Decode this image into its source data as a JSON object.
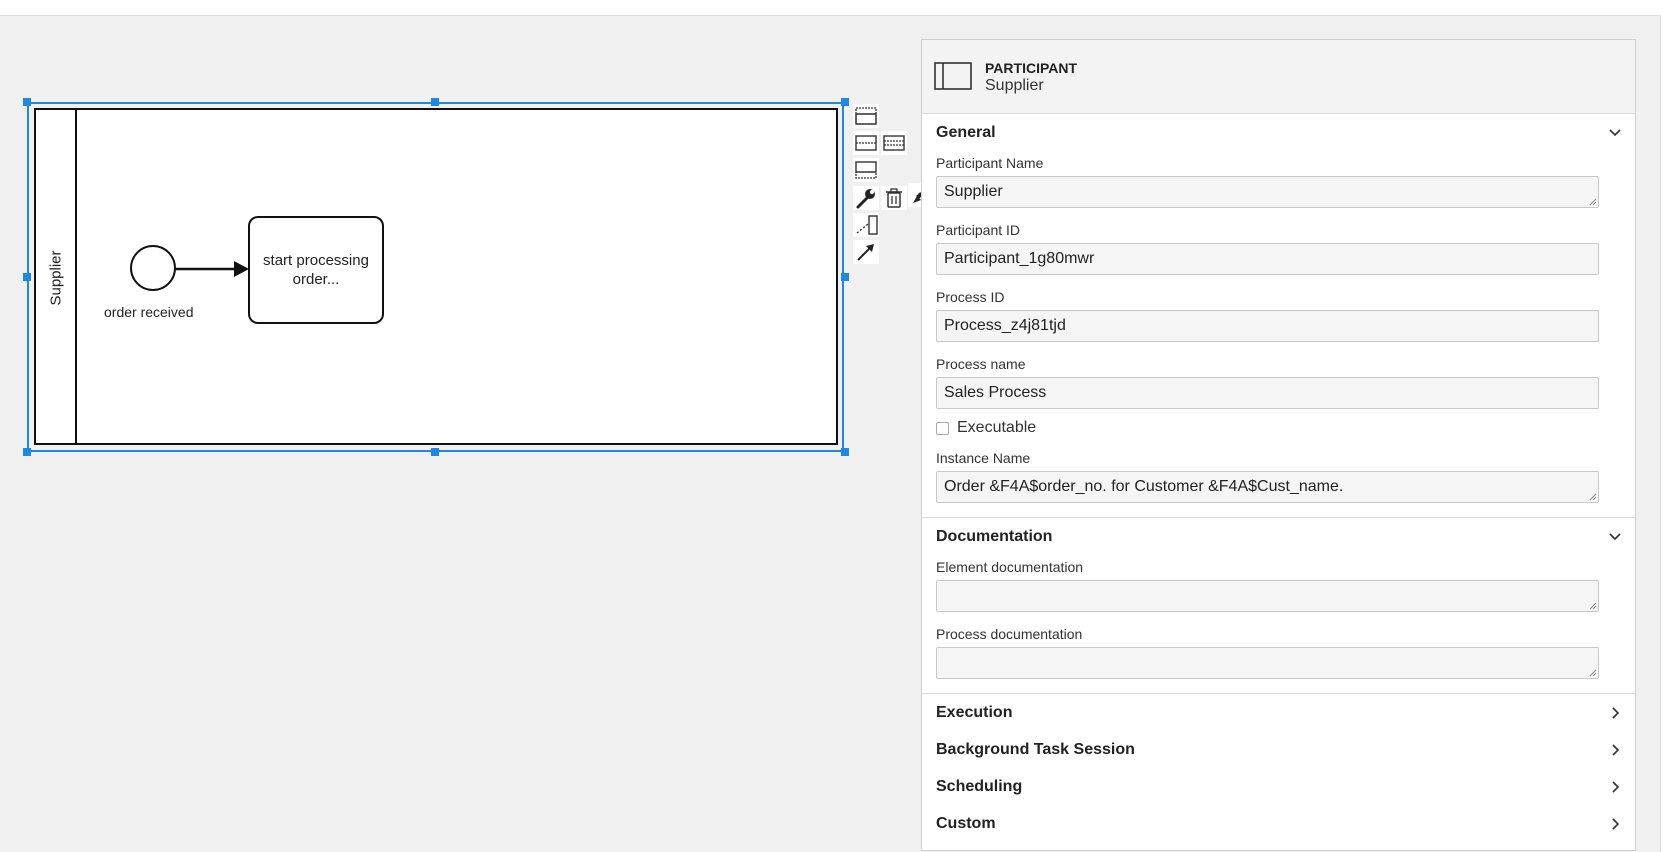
{
  "diagram": {
    "pool_name": "Supplier",
    "start_event_label": "order received",
    "task_label": "start processing order..."
  },
  "panel": {
    "element_type": "PARTICIPANT",
    "element_name": "Supplier",
    "groups": {
      "general": {
        "title": "General",
        "participant_name_label": "Participant Name",
        "participant_name_value": "Supplier",
        "participant_id_label": "Participant ID",
        "participant_id_value": "Participant_1g80mwr",
        "process_id_label": "Process ID",
        "process_id_value": "Process_z4j81tjd",
        "process_name_label": "Process name",
        "process_name_value": "Sales Process",
        "executable_label": "Executable",
        "instance_name_label": "Instance Name",
        "instance_name_value": "Order &F4A$order_no. for Customer &F4A$Cust_name."
      },
      "documentation": {
        "title": "Documentation",
        "element_doc_label": "Element documentation",
        "element_doc_value": "",
        "process_doc_label": "Process documentation",
        "process_doc_value": ""
      },
      "execution": {
        "title": "Execution"
      },
      "background": {
        "title": "Background Task Session"
      },
      "scheduling": {
        "title": "Scheduling"
      },
      "custom": {
        "title": "Custom"
      }
    }
  }
}
